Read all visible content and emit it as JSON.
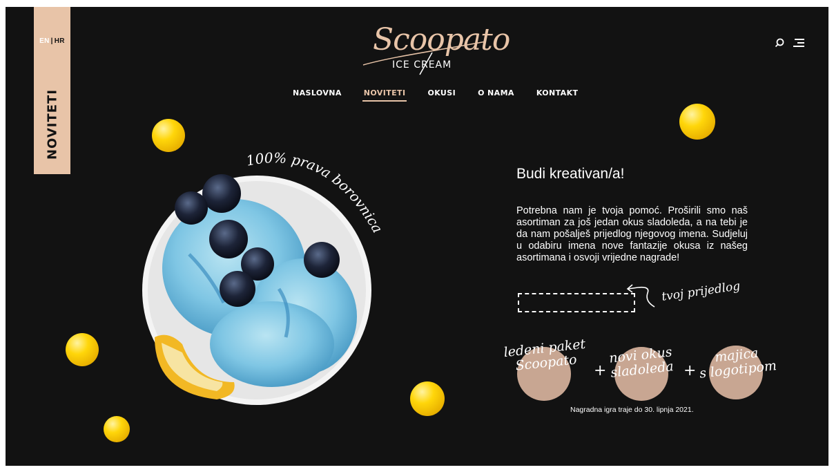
{
  "lang": {
    "en": "EN",
    "hr": "HR"
  },
  "side_tab": {
    "label": "NOVITETI"
  },
  "logo": {
    "script": "Scoopato",
    "sub": "ICE CREAM"
  },
  "icons": {
    "search": "search-icon",
    "menu": "menu-icon"
  },
  "nav": {
    "items": [
      {
        "label": "NASLOVNA",
        "active": false
      },
      {
        "label": "NOVITETI",
        "active": true
      },
      {
        "label": "OKUSI",
        "active": false
      },
      {
        "label": "O NAMA",
        "active": false
      },
      {
        "label": "KONTAKT",
        "active": false
      }
    ]
  },
  "hero": {
    "arc_text": "100% prava borovnica"
  },
  "promo": {
    "title": "Budi kreativan/a!",
    "body": "Potrebna nam je tvoja pomoć. Proširili smo naš asortiman za još jedan okus sladoleda, a na tebi je da nam pošalješ prijedlog njegovog imena. Sudjeluj u odabiru imena nove fantazije okusa iz našeg asortimana i osvoji vrijedne nagrade!",
    "input_value": "",
    "input_label": "tvoj prijedlog",
    "prizes": [
      {
        "line1": "ledeni paket",
        "line2": "Scoopato"
      },
      {
        "line1": "novi okus",
        "line2": "sladoleda"
      },
      {
        "line1": "majica",
        "line2": "s logotipom"
      }
    ],
    "plus": "+",
    "footnote": "Nagradna igra traje do 30. lipnja 2021."
  },
  "colors": {
    "background": "#121212",
    "accent": "#e8c4a8",
    "prize_circle": "#c8a692",
    "ball": "#ffd60a"
  }
}
